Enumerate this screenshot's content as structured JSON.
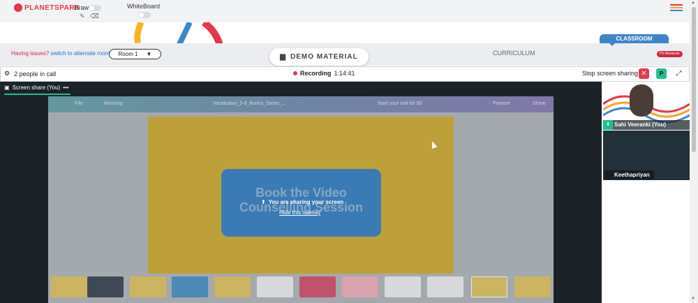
{
  "app": {
    "logo_text": "PLANETSPARK"
  },
  "toolbar": {
    "draw_label": "Draw",
    "whiteboard_label": "WhiteBoard"
  },
  "classbar": {
    "issue_text": "Having issues?",
    "issue_link": "switch to alternate room",
    "room_value": "Room 1",
    "demo_material": "DEMO MATERIAL",
    "curriculum": "CURRICULUM",
    "classroom_tab": "CLASSROOM",
    "moments_badge": "PS Moments"
  },
  "call": {
    "people": "2 people in call",
    "recording_label": "Recording",
    "recording_time": "1:14:41",
    "stop_share": "Stop screen sharing",
    "p_button": "P"
  },
  "share": {
    "tab_label": "Screen share (You)",
    "sharing_msg": "You are sharing your screen",
    "hide_overlay": "Hide this overlay",
    "slide_line1": "Book the Video",
    "slide_line2": "Counselling Session",
    "canva": {
      "file": "File",
      "resize": "Resizing",
      "doc_title": "Vocabulary_5-8_Bonus_Demo_...",
      "trial": "Start your trial for 90",
      "present": "Present",
      "share": "Share"
    }
  },
  "participants": [
    {
      "name": "Sahi Veeranki (You)"
    },
    {
      "name": "Keethapriyan"
    }
  ],
  "colors": {
    "accent": "#1fbf8f",
    "brand": "#e8354d",
    "classroom": "#3f86c9"
  }
}
